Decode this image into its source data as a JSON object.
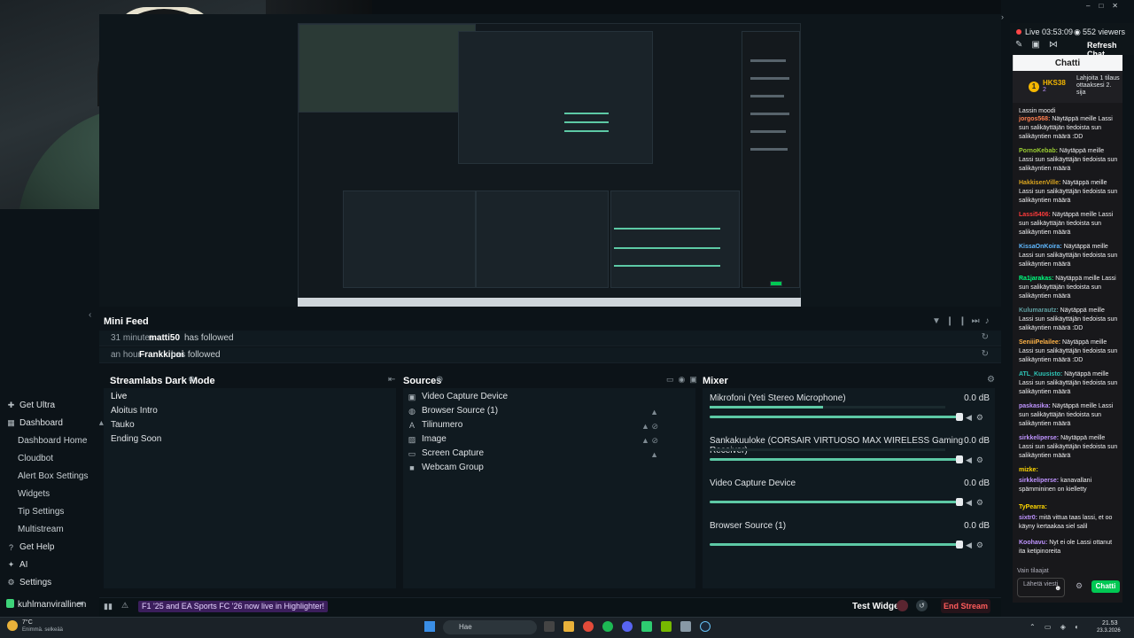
{
  "window": {
    "controls": [
      "–",
      "□",
      "✕"
    ]
  },
  "mini_feed": {
    "title": "Mini Feed",
    "rows": [
      {
        "time": "31 minutes",
        "user": "matti50",
        "action": "has followed"
      },
      {
        "time": "an hour",
        "user": "Frankkipoi",
        "action": "has followed"
      }
    ]
  },
  "scenes": {
    "title": "Streamlabs Dark Mode",
    "items": [
      "Live",
      "Aloitus Intro",
      "Tauko",
      "Ending Soon"
    ]
  },
  "sources": {
    "title": "Sources",
    "items": [
      {
        "label": "Video Capture Device",
        "icon": "camera-icon"
      },
      {
        "label": "Browser Source (1)",
        "icon": "globe-icon"
      },
      {
        "label": "Tilinumero",
        "icon": "text-icon"
      },
      {
        "label": "Image",
        "icon": "image-icon"
      },
      {
        "label": "Screen Capture",
        "icon": "monitor-icon"
      },
      {
        "label": "Webcam Group",
        "icon": "folder-icon"
      }
    ]
  },
  "mixer": {
    "title": "Mixer",
    "channels": [
      {
        "name": "Mikrofoni (Yeti Stereo Microphone)",
        "db": "0.0 dB",
        "level": 0.48
      },
      {
        "name": "Sankakuuloke (CORSAIR VIRTUOSO MAX WIRELESS Gaming Receiver)",
        "db": "0.0 dB",
        "level": 0.0
      },
      {
        "name": "Video Capture Device",
        "db": "0.0 dB",
        "level": 0.0
      },
      {
        "name": "Browser Source (1)",
        "db": "0.0 dB",
        "level": 0.0
      }
    ]
  },
  "nav": {
    "get_ultra": "Get Ultra",
    "dashboard": "Dashboard",
    "sub": [
      "Dashboard Home",
      "Cloudbot",
      "Alert Box Settings",
      "Widgets",
      "Tip Settings",
      "Multistream"
    ],
    "get_help": "Get Help",
    "ai": "AI",
    "settings": "Settings",
    "user": "kuhlmanvirallinen"
  },
  "bottom_bar": {
    "promo": "F1 '25 and EA Sports FC '26 now live in Highlighter!",
    "test_widgets": "Test Widgets",
    "end_stream": "End Stream"
  },
  "chat": {
    "live_time": "Live 03:53:09",
    "viewers": "552 viewers",
    "refresh": "Refresh Chat",
    "title": "Chatti",
    "hype_name": "HKS38",
    "hype_rank": "2",
    "hype_text": "Lahjoita 1 tilaus ottaaksesi 2. sija",
    "partial": "Lassin moodi",
    "messages": [
      {
        "user": "jorgos568",
        "color": "#ff7f50",
        "text": "Näytäppä meille Lassi sun salikäyttäjän tiedoista sun salikäyntien määrä :DD"
      },
      {
        "user": "PornoKebab",
        "color": "#9acd32",
        "text": "Näytäppä meille Lassi sun salikäyttäjän tiedoista sun salikäyntien määrä"
      },
      {
        "user": "HakkisenVille",
        "color": "#daa520",
        "text": "Näytäppä meille Lassi sun salikäyttäjän tiedoista sun salikäyntien määrä"
      },
      {
        "user": "Lassi5406",
        "color": "#ff3b3b",
        "text": "Näytäppä meille Lassi sun salikäyttäjän tiedoista sun salikäyntien määrä"
      },
      {
        "user": "KissaOnKoira",
        "color": "#5fb8ff",
        "text": "Näytäppä meille Lassi sun salikäyttäjän tiedoista sun salikäyntien määrä"
      },
      {
        "user": "Ra1jarakas",
        "color": "#00ff7f",
        "text": "Näytäppä meille Lassi sun salikäyttäjän tiedoista sun salikäyntien määrä"
      },
      {
        "user": "Kulumarautz",
        "color": "#5f9ea0",
        "text": "Näytäppä meille Lassi sun salikäyttäjän tiedoista sun salikäyntien määrä :DD"
      },
      {
        "user": "SeniiiPelailee",
        "color": "#ffb347",
        "text": "Näytäppä meille Lassi sun salikäyttäjän tiedoista sun salikäyntien määrä :DD"
      },
      {
        "user": "ATL_Kuusisto",
        "color": "#2ec4b6",
        "text": "Näytäppä meille Lassi sun salikäyttäjän tiedoista sun salikäyntien määrä"
      },
      {
        "user": "paskasika",
        "color": "#bf94ff",
        "text": "Näytäppä meille Lassi sun salikäyttäjän tiedoista sun salikäyntien määrä"
      },
      {
        "user": "sirkkeliperse",
        "color": "#bf94ff",
        "text": "Näytäppä meille Lassi sun salikäyttäjän tiedoista sun salikäyntien määrä"
      },
      {
        "user": "mizke",
        "color": "#ffd700",
        "text": ""
      },
      {
        "user": "sirkkeliperse",
        "color": "#bf94ff",
        "text": "kanavallani spämmininen on kielletty"
      },
      {
        "user": "TyPearra",
        "color": "#ffd700",
        "text": ""
      },
      {
        "user": "sixtr0",
        "color": "#bf94ff",
        "text": "mitä vittua taas lassi, et oo käyny kertaakaa siel salil"
      },
      {
        "user": "Koohavu",
        "color": "#bf94ff",
        "text": "Nyt ei ole Lassi ottanut ita ketipinoreita"
      }
    ],
    "vain_tilaajat": "Vain tilaajat",
    "input_placeholder": "Lähetä viesti",
    "send": "Chatti"
  },
  "taskbar": {
    "temp": "7°C",
    "weather": "Enimmä. selkeää",
    "search": "Hae",
    "time": "21.53",
    "date": "23.3.2026"
  },
  "colors": {
    "accent": "#5dc9a5",
    "live": "#ff4747",
    "chat_button": "#00c853"
  }
}
